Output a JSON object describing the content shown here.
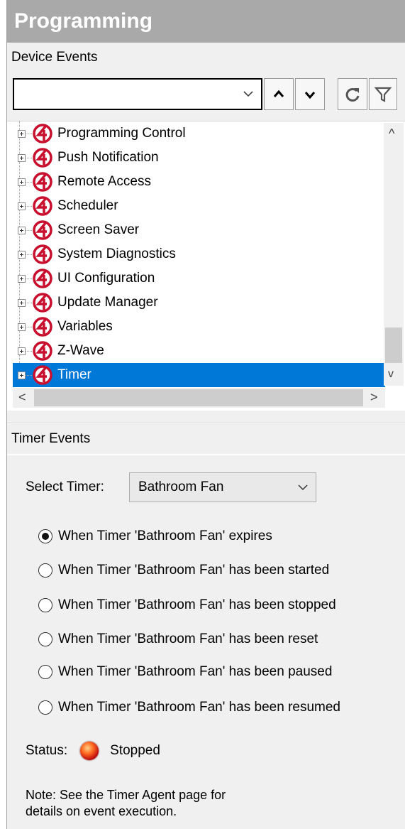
{
  "title": "Programming",
  "device_events_header": "Device Events",
  "toolbar": {
    "search_value": "",
    "buttons": [
      {
        "name": "up-arrow-button",
        "icon": "chevron-up-icon"
      },
      {
        "name": "down-arrow-button",
        "icon": "chevron-down-icon"
      },
      {
        "name": "refresh-button",
        "icon": "refresh-icon"
      },
      {
        "name": "filter-button",
        "icon": "filter-icon"
      }
    ]
  },
  "tree": {
    "items": [
      {
        "label": "Programming Control"
      },
      {
        "label": "Push Notification"
      },
      {
        "label": "Remote Access"
      },
      {
        "label": "Scheduler"
      },
      {
        "label": "Screen Saver"
      },
      {
        "label": "System Diagnostics"
      },
      {
        "label": "UI Configuration"
      },
      {
        "label": "Update Manager"
      },
      {
        "label": "Variables"
      },
      {
        "label": "Z-Wave"
      },
      {
        "label": "Timer"
      }
    ],
    "selected_index": 10,
    "icon": "control4-logo-icon",
    "accent": "#c8102e",
    "selection_color": "#0078d7"
  },
  "timer_events": {
    "header": "Timer Events",
    "select_label": "Select Timer:",
    "select_value": "Bathroom Fan",
    "radios": [
      {
        "label": "When Timer 'Bathroom Fan' expires",
        "checked": true
      },
      {
        "label": "When Timer 'Bathroom Fan' has been started",
        "checked": false
      },
      {
        "label": "When Timer 'Bathroom Fan' has been stopped",
        "checked": false
      },
      {
        "label": "When Timer 'Bathroom Fan' has been reset",
        "checked": false
      },
      {
        "label": "When Timer 'Bathroom Fan' has been paused",
        "checked": false
      },
      {
        "label": "When Timer 'Bathroom Fan' has been resumed",
        "checked": false
      }
    ],
    "status_label": "Status:",
    "status_value": "Stopped",
    "note_line1": "Note: See the Timer Agent page for",
    "note_line2": "details on event execution."
  }
}
